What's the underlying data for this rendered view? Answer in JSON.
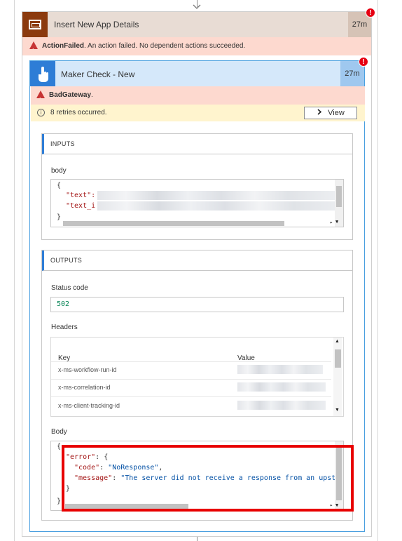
{
  "outer_action": {
    "title": "Insert New App Details",
    "duration": "27m",
    "error_badge": "!",
    "error_bold": "ActionFailed",
    "error_text": ". An action failed. No dependent actions succeeded."
  },
  "inner_action": {
    "title": "Maker Check - New",
    "duration": "27m",
    "error_badge": "!",
    "error_bold": "BadGateway",
    "error_suffix": ".",
    "retry_text": "8 retries occurred.",
    "view_label": "View"
  },
  "inputs": {
    "section_label": "INPUTS",
    "body_label": "body",
    "lines": [
      "{",
      "\"text\":",
      "\"text_i",
      "}"
    ]
  },
  "outputs": {
    "section_label": "OUTPUTS",
    "status_label": "Status code",
    "status_value": "502",
    "headers_label": "Headers",
    "headers_columns": [
      "Key",
      "Value"
    ],
    "headers_rows": [
      {
        "key": "x-ms-workflow-run-id"
      },
      {
        "key": "x-ms-correlation-id"
      },
      {
        "key": "x-ms-client-tracking-id"
      }
    ],
    "body_label": "Body",
    "body_lines": {
      "open": "{",
      "error_key": "\"error\"",
      "error_rest": ": {",
      "code_key": "\"code\"",
      "code_sep": ": ",
      "code_value": "\"NoResponse\"",
      "code_end": ",",
      "message_key": "\"message\"",
      "message_sep": ": ",
      "message_value": "\"The server did not receive a response from an upst",
      "inner_close": "}",
      "close": "}"
    }
  },
  "colors": {
    "error_red": "#e60012",
    "highlight_red": "#e80000",
    "accent_blue": "#2e7dd6",
    "outer_icon_brown": "#8b3a0e"
  }
}
